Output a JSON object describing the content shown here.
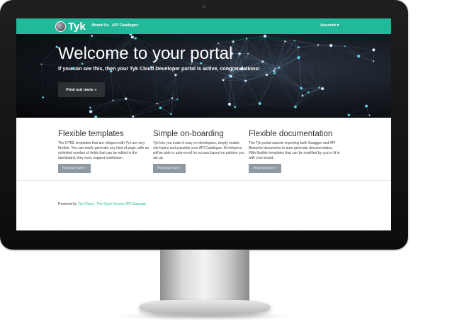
{
  "navbar": {
    "brand": "Tyk",
    "links": [
      "About Us",
      "API Catalogue"
    ],
    "account": "Account ▾"
  },
  "hero": {
    "title": "Welcome to your portal",
    "subtitle": "If you can see this, then your Tyk Cloud Developer portal is active, congratulations!",
    "button": "Find out more »"
  },
  "features": [
    {
      "title": "Flexible templates",
      "text": "The HTML templates that are shipped with Tyk are very flexible. You can easily generate any kind of page, with an unlimited number of fields that can be edited in the dashboard, they even support markdown.",
      "button": "Find out more »"
    },
    {
      "title": "Simple on-boarding",
      "text": "Tyk lets you make it easy on developers, simply enable site logins and populate your API Catalogue. Developers will be able to auto-enroll for access based on policies you set up.",
      "button": "Find out more »"
    },
    {
      "title": "Flexible documentation",
      "text": "The Tyk portal suports importing both Swagger and API Blueprint documents to auto-generate documentation. With flexible templates that can be modified by you to fit in with your brand.",
      "button": "Find out more »"
    }
  ],
  "footer": {
    "prefix": "Powered by ",
    "link": "Tyk Cloud - The Open Source API Gateway"
  },
  "colors": {
    "accent": "#22b99a",
    "hero_bg": "#11151b",
    "button_dark": "#2c3035",
    "button_grey": "#8e9aa3"
  }
}
